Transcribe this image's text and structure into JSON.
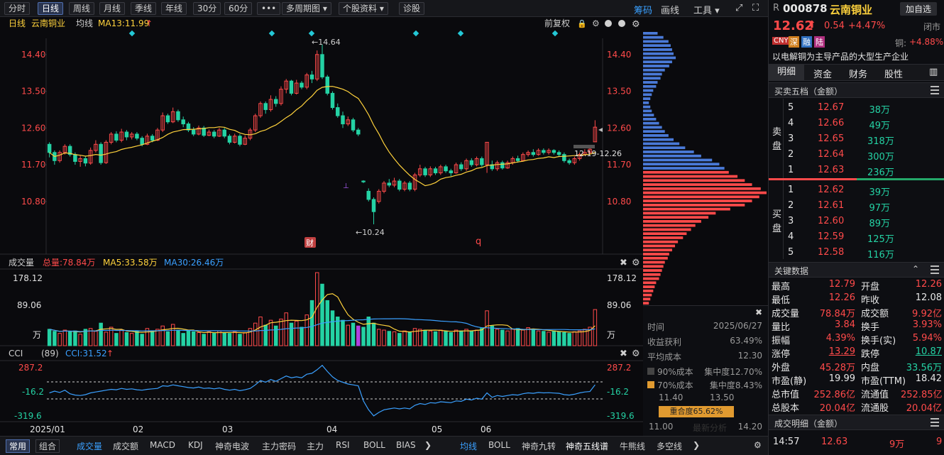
{
  "toolbar": {
    "periods": [
      "分时",
      "日线",
      "周线",
      "月线",
      "季线",
      "年线",
      "30分",
      "60分"
    ],
    "more": "•••",
    "multi": "多周期图",
    "info": "个股资料",
    "diag": "诊股",
    "chouma": "筹码",
    "huaxian": "画线",
    "tools": "工具"
  },
  "chart": {
    "period_label": "日线",
    "name": "云南铜业",
    "avg_label": "均线",
    "ma13": "MA13:11.99",
    "fuquan": "前复权",
    "price_ticks": [
      "14.40",
      "13.50",
      "12.60",
      "11.70",
      "10.80"
    ],
    "hi_mark": "←14.64",
    "lo_mark": "←10.24",
    "range_label": "12.19-12.26",
    "cai_badge": "财",
    "q_badge": "q",
    "vol": {
      "title": "成交量",
      "total": "总量:78.84万",
      "ma5": "MA5:33.58万",
      "ma30": "MA30:26.46万",
      "ticks": [
        "178.12",
        "89.06",
        "万"
      ]
    },
    "cci": {
      "title": "CCI",
      "param": "(89)",
      "value": "CCI:31.52",
      "ticks": [
        "287.2",
        "-16.2",
        "-319.6"
      ]
    },
    "x_labels": [
      "2025/01",
      "02",
      "03",
      "04",
      "05",
      "06"
    ]
  },
  "chart_data": {
    "type": "candlestick",
    "price_range": [
      10.1,
      14.9
    ],
    "candles": [
      [
        12.2,
        12.0,
        12.25,
        11.88
      ],
      [
        12.0,
        11.8,
        12.05,
        11.7
      ],
      [
        11.8,
        12.0,
        12.05,
        11.75
      ],
      [
        12.0,
        12.15,
        12.2,
        11.95
      ],
      [
        12.15,
        11.95,
        12.2,
        11.9
      ],
      [
        11.95,
        11.78,
        12.0,
        11.7
      ],
      [
        11.78,
        11.85,
        11.92,
        11.65
      ],
      [
        11.85,
        11.74,
        11.9,
        11.66
      ],
      [
        11.74,
        12.05,
        12.12,
        11.7
      ],
      [
        12.05,
        12.2,
        12.3,
        12.0
      ],
      [
        12.2,
        11.75,
        12.25,
        11.7
      ],
      [
        11.75,
        12.25,
        12.3,
        11.72
      ],
      [
        12.25,
        12.45,
        12.5,
        12.2
      ],
      [
        12.45,
        12.3,
        12.52,
        12.25
      ],
      [
        12.3,
        12.5,
        12.58,
        12.25
      ],
      [
        12.5,
        12.38,
        12.55,
        12.3
      ],
      [
        12.38,
        12.45,
        12.5,
        12.32
      ],
      [
        12.45,
        12.35,
        12.5,
        12.3
      ],
      [
        12.35,
        12.2,
        12.4,
        12.15
      ],
      [
        12.2,
        12.4,
        12.46,
        12.18
      ],
      [
        12.4,
        12.3,
        12.45,
        12.25
      ],
      [
        12.3,
        12.55,
        12.6,
        12.28
      ],
      [
        12.55,
        12.9,
        12.98,
        12.5
      ],
      [
        12.9,
        12.75,
        12.95,
        12.7
      ],
      [
        12.75,
        13.0,
        13.1,
        12.72
      ],
      [
        13.0,
        12.8,
        13.05,
        12.75
      ],
      [
        12.8,
        12.7,
        12.88,
        12.62
      ],
      [
        12.7,
        12.55,
        12.75,
        12.5
      ],
      [
        12.55,
        12.45,
        12.62,
        12.4
      ],
      [
        12.45,
        12.6,
        12.66,
        12.42
      ],
      [
        12.6,
        12.42,
        12.65,
        12.38
      ],
      [
        12.42,
        12.5,
        12.56,
        12.4
      ],
      [
        12.5,
        12.4,
        12.55,
        12.35
      ],
      [
        12.4,
        12.55,
        12.6,
        12.38
      ],
      [
        12.55,
        12.4,
        12.6,
        12.35
      ],
      [
        12.4,
        12.25,
        12.45,
        12.2
      ],
      [
        12.25,
        12.4,
        12.46,
        12.22
      ],
      [
        12.4,
        12.2,
        12.45,
        12.15
      ],
      [
        12.2,
        12.35,
        12.42,
        12.18
      ],
      [
        12.35,
        12.55,
        12.6,
        12.3
      ],
      [
        12.55,
        12.9,
        12.95,
        12.5
      ],
      [
        12.9,
        13.2,
        13.25,
        12.85
      ],
      [
        13.2,
        13.05,
        13.25,
        12.95
      ],
      [
        13.05,
        13.3,
        13.4,
        13.0
      ],
      [
        13.3,
        13.2,
        13.38,
        13.12
      ],
      [
        13.2,
        13.55,
        13.62,
        13.15
      ],
      [
        13.55,
        13.75,
        13.8,
        13.45
      ],
      [
        13.75,
        13.45,
        13.78,
        13.4
      ],
      [
        13.45,
        13.7,
        13.78,
        13.42
      ],
      [
        13.7,
        13.6,
        13.75,
        13.55
      ],
      [
        13.6,
        13.9,
        13.95,
        13.55
      ],
      [
        13.9,
        13.8,
        14.0,
        13.7
      ],
      [
        13.8,
        14.4,
        14.5,
        13.75
      ],
      [
        14.4,
        13.85,
        14.64,
        13.8
      ],
      [
        13.85,
        13.45,
        13.9,
        13.4
      ],
      [
        13.45,
        13.1,
        13.5,
        13.05
      ],
      [
        13.1,
        12.9,
        13.2,
        12.85
      ],
      [
        12.9,
        12.7,
        13.0,
        12.6
      ],
      [
        12.7,
        12.8,
        12.88,
        12.65
      ],
      [
        12.8,
        12.55,
        12.85,
        12.5
      ],
      [
        12.55,
        12.45,
        12.6,
        12.4
      ],
      [
        11.3,
        11.28,
        11.32,
        11.25
      ],
      [
        11.05,
        10.85,
        11.12,
        10.8
      ],
      [
        10.85,
        10.55,
        10.9,
        10.24
      ],
      [
        10.8,
        11.05,
        11.1,
        10.75
      ],
      [
        11.05,
        11.25,
        11.3,
        11.0
      ],
      [
        11.25,
        11.2,
        11.35,
        11.15
      ],
      [
        11.2,
        11.3,
        11.38,
        11.15
      ],
      [
        11.3,
        11.1,
        11.35,
        11.05
      ],
      [
        11.1,
        11.25,
        11.3,
        11.05
      ],
      [
        11.25,
        11.1,
        11.3,
        11.05
      ],
      [
        11.1,
        11.45,
        11.5,
        11.05
      ],
      [
        11.45,
        11.6,
        11.7,
        11.4
      ],
      [
        11.6,
        11.45,
        11.65,
        11.4
      ],
      [
        11.45,
        11.6,
        11.66,
        11.4
      ],
      [
        11.6,
        11.5,
        11.65,
        11.45
      ],
      [
        11.5,
        11.65,
        11.7,
        11.45
      ],
      [
        11.65,
        11.55,
        11.7,
        11.5
      ],
      [
        11.55,
        11.5,
        11.6,
        11.42
      ],
      [
        11.5,
        11.7,
        11.75,
        11.48
      ],
      [
        11.7,
        11.6,
        11.76,
        11.55
      ],
      [
        11.6,
        11.8,
        11.85,
        11.55
      ],
      [
        11.8,
        11.7,
        11.86,
        11.65
      ],
      [
        11.7,
        11.85,
        11.9,
        11.66
      ],
      [
        11.85,
        11.7,
        11.9,
        11.65
      ],
      [
        11.7,
        12.25,
        12.25,
        11.5
      ],
      [
        11.7,
        11.6,
        11.8,
        11.55
      ],
      [
        11.6,
        11.75,
        11.8,
        11.55
      ],
      [
        11.75,
        11.62,
        11.8,
        11.58
      ],
      [
        11.62,
        11.75,
        11.8,
        11.6
      ],
      [
        11.75,
        11.85,
        11.9,
        11.7
      ],
      [
        11.85,
        11.8,
        11.92,
        11.75
      ],
      [
        11.8,
        11.95,
        12.0,
        11.78
      ],
      [
        11.95,
        12.0,
        12.05,
        11.9
      ],
      [
        12.0,
        11.95,
        12.08,
        11.9
      ],
      [
        11.95,
        12.05,
        12.1,
        11.92
      ],
      [
        12.05,
        12.0,
        12.1,
        11.95
      ],
      [
        12.0,
        12.05,
        12.1,
        11.95
      ],
      [
        12.05,
        12.0,
        12.08,
        11.95
      ],
      [
        12.0,
        11.95,
        12.05,
        11.9
      ],
      [
        11.95,
        11.8,
        12.0,
        11.75
      ],
      [
        11.8,
        11.75,
        11.85,
        11.7
      ],
      [
        11.75,
        11.85,
        11.9,
        11.7
      ],
      [
        11.85,
        11.95,
        12.0,
        11.8
      ],
      [
        11.95,
        12.0,
        12.08,
        11.92
      ],
      [
        12.0,
        12.08,
        12.12,
        11.95
      ],
      [
        12.26,
        12.62,
        12.79,
        12.26
      ]
    ],
    "volume_max": 178.12,
    "volumes": [
      40,
      35,
      30,
      38,
      34,
      36,
      28,
      40,
      42,
      35,
      55,
      33,
      45,
      30,
      38,
      32,
      30,
      35,
      28,
      42,
      36,
      40,
      48,
      34,
      52,
      38,
      30,
      36,
      34,
      32,
      28,
      34,
      30,
      36,
      32,
      30,
      34,
      28,
      32,
      42,
      55,
      70,
      50,
      62,
      48,
      65,
      80,
      55,
      60,
      45,
      75,
      110,
      178,
      150,
      110,
      85,
      70,
      62,
      50,
      55,
      48,
      45,
      70,
      55,
      40,
      38,
      35,
      34,
      30,
      36,
      33,
      42,
      40,
      38,
      36,
      34,
      38,
      35,
      32,
      38,
      36,
      40,
      35,
      38,
      42,
      85,
      48,
      40,
      38,
      36,
      40,
      42,
      38,
      44,
      40,
      36,
      35,
      33,
      36,
      34,
      32,
      30,
      34,
      36,
      40,
      45,
      88
    ],
    "cci": [
      -60,
      -40,
      -55,
      -30,
      -70,
      -85,
      -90,
      -80,
      -60,
      -50,
      -40,
      -30,
      -20,
      -25,
      -10,
      -20,
      -15,
      -25,
      -30,
      -20,
      -15,
      -10,
      20,
      15,
      30,
      20,
      10,
      0,
      -5,
      5,
      -10,
      -5,
      -15,
      -5,
      -20,
      -30,
      -20,
      -35,
      -25,
      -10,
      30,
      80,
      60,
      90,
      70,
      100,
      130,
      110,
      120,
      110,
      150,
      160,
      200,
      250,
      180,
      120,
      80,
      60,
      40,
      30,
      20,
      -150,
      -250,
      -319,
      -280,
      -250,
      -240,
      -230,
      -240,
      -230,
      -240,
      -200,
      -180,
      -190,
      -170,
      -175,
      -160,
      -165,
      -170,
      -150,
      -155,
      -130,
      -140,
      -120,
      -130,
      -60,
      -110,
      -90,
      -100,
      -90,
      -80,
      -85,
      -70,
      -60,
      -65,
      -55,
      -60,
      -58,
      -62,
      -65,
      -80,
      -85,
      -75,
      -60,
      -50,
      -45,
      31
    ]
  },
  "volume_profile": {
    "bars": [
      20,
      28,
      35,
      38,
      40,
      42,
      45,
      40,
      36,
      30,
      26,
      24,
      20,
      18,
      14,
      12,
      10,
      8,
      10,
      12,
      15,
      18,
      22,
      26,
      30,
      35,
      42,
      50,
      58,
      70,
      80,
      95,
      105,
      112,
      118,
      130,
      140,
      150,
      162,
      170,
      160,
      150,
      140,
      120,
      100,
      90,
      80,
      72,
      66,
      60,
      55,
      48,
      44,
      40,
      36,
      34,
      30,
      28,
      26,
      24,
      22,
      18,
      16,
      14,
      12,
      10,
      8
    ]
  },
  "cost": {
    "time_label": "时间",
    "time": "2025/06/27",
    "profit_label": "收益获利",
    "profit": "63.49%",
    "avg_label": "平均成本",
    "avg": "12.30",
    "c90_label": "90%成本",
    "c90_conc": "集中度12.70%",
    "c70_label": "70%成本",
    "c70_conc": "集中度8.43%",
    "range_lo": "11.40",
    "range_hi": "13.50",
    "overlap": "重合度65.62%",
    "axis_lo": "11.00",
    "axis_hi": "14.20",
    "faded": "最新分析"
  },
  "bottom": {
    "left_tabs": [
      "常用",
      "组合"
    ],
    "tabs": [
      "成交量",
      "成交额",
      "MACD",
      "KDJ",
      "神奇电波",
      "主力密码",
      "主力",
      "RSI",
      "BOLL",
      "BIAS"
    ],
    "right_tabs": [
      "均线",
      "BOLL",
      "神奇九转",
      "神奇五线谱",
      "牛熊线",
      "多空线"
    ]
  },
  "quote": {
    "r": "R",
    "code": "000878",
    "name": "云南铜业",
    "add_btn": "加自选",
    "price": "12.62",
    "change": "0.54",
    "pct": "+4.47%",
    "status": "闭市",
    "badges": [
      "CNY",
      "深",
      "融",
      "陆"
    ],
    "sector": "铜:",
    "sector_pct": "+4.88%",
    "desc": "以电解铜为主导产品的大型生产企业",
    "tabs": [
      "明细",
      "资金",
      "财务",
      "股性"
    ],
    "book_title": "买卖五档（金额）",
    "sell_label": "卖盘",
    "buy_label": "买盘",
    "sells": [
      {
        "lv": "5",
        "p": "12.67",
        "v": "38万"
      },
      {
        "lv": "4",
        "p": "12.66",
        "v": "49万"
      },
      {
        "lv": "3",
        "p": "12.65",
        "v": "318万"
      },
      {
        "lv": "2",
        "p": "12.64",
        "v": "300万"
      },
      {
        "lv": "1",
        "p": "12.63",
        "v": "236万"
      }
    ],
    "buys": [
      {
        "lv": "1",
        "p": "12.62",
        "v": "39万"
      },
      {
        "lv": "2",
        "p": "12.61",
        "v": "97万"
      },
      {
        "lv": "3",
        "p": "12.60",
        "v": "89万"
      },
      {
        "lv": "4",
        "p": "12.59",
        "v": "125万"
      },
      {
        "lv": "5",
        "p": "12.58",
        "v": "116万"
      }
    ],
    "key_title": "关键数据",
    "key": [
      [
        "最高",
        "12.79",
        "red",
        "开盘",
        "12.26",
        "red"
      ],
      [
        "最低",
        "12.26",
        "red",
        "昨收",
        "12.08",
        "white"
      ],
      [
        "成交量",
        "78.84万",
        "red",
        "成交额",
        "9.92亿",
        "red"
      ],
      [
        "量比",
        "3.84",
        "red",
        "换手",
        "3.93%",
        "red"
      ],
      [
        "振幅",
        "4.39%",
        "red",
        "换手(实)",
        "5.94%",
        "red"
      ],
      [
        "涨停",
        "13.29",
        "red",
        "跌停",
        "10.87",
        "green"
      ],
      [
        "外盘",
        "45.28万",
        "red",
        "内盘",
        "33.56万",
        "green"
      ],
      [
        "市盈(静)",
        "19.99",
        "white",
        "市盈(TTM)",
        "18.42",
        "white"
      ],
      [
        "总市值",
        "252.86亿",
        "red",
        "流通值",
        "252.85亿",
        "red"
      ],
      [
        "总股本",
        "20.04亿",
        "red",
        "流通股",
        "20.04亿",
        "red"
      ]
    ],
    "detail_title": "成交明细（金额）",
    "detail_row": {
      "time": "14:57",
      "price": "12.63",
      "vol": "9万",
      "n": "9"
    }
  },
  "colors": {
    "up": "#ff4a4a",
    "down": "#24d2a4",
    "ma": "#ffd23c",
    "ma30": "#3aa0ff",
    "cci": "#3aa0ff",
    "profile": "#ff4a4a",
    "profile_dn": "#4a7ad8"
  }
}
